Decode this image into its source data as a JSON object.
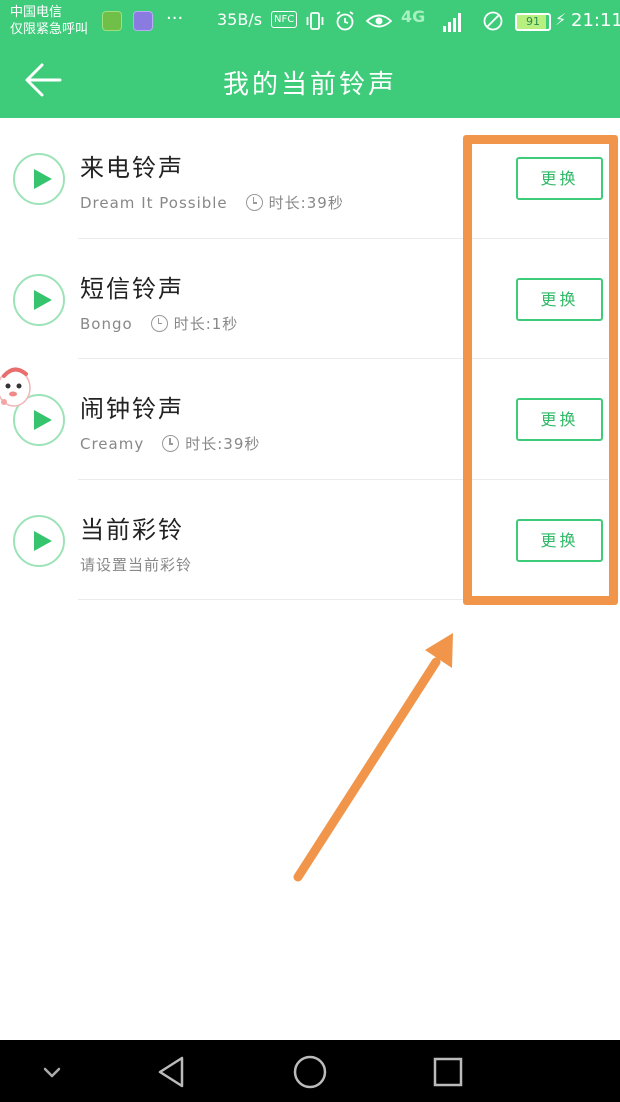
{
  "status_bar": {
    "carrier_line1": "中国电信",
    "carrier_line2": "仅限紧急呼叫",
    "overflow": "···",
    "speed": "35B/s",
    "nfc": "NFC",
    "network": "4G",
    "battery": "91",
    "time": "21:11"
  },
  "header": {
    "title": "我的当前铃声"
  },
  "ringtones": [
    {
      "title": "来电铃声",
      "song": "Dream It Possible",
      "duration": "时长:39秒",
      "button": "更换"
    },
    {
      "title": "短信铃声",
      "song": "Bongo",
      "duration": "时长:1秒",
      "button": "更换"
    },
    {
      "title": "闹钟铃声",
      "song": "Creamy",
      "duration": "时长:39秒",
      "button": "更换"
    },
    {
      "title": "当前彩铃",
      "song": "请设置当前彩铃",
      "duration": "",
      "button": "更换"
    }
  ],
  "icons": {
    "back": "arrow-left-icon",
    "play": "play-icon",
    "clock": "clock-icon",
    "nav_hide": "chevron-down-icon",
    "nav_back": "triangle-back-icon",
    "nav_home": "circle-home-icon",
    "nav_recent": "square-recent-icon"
  },
  "colors": {
    "brand_green": "#3ecc7a",
    "annotation_orange": "#f0954a",
    "nav_bar": "#000000"
  }
}
